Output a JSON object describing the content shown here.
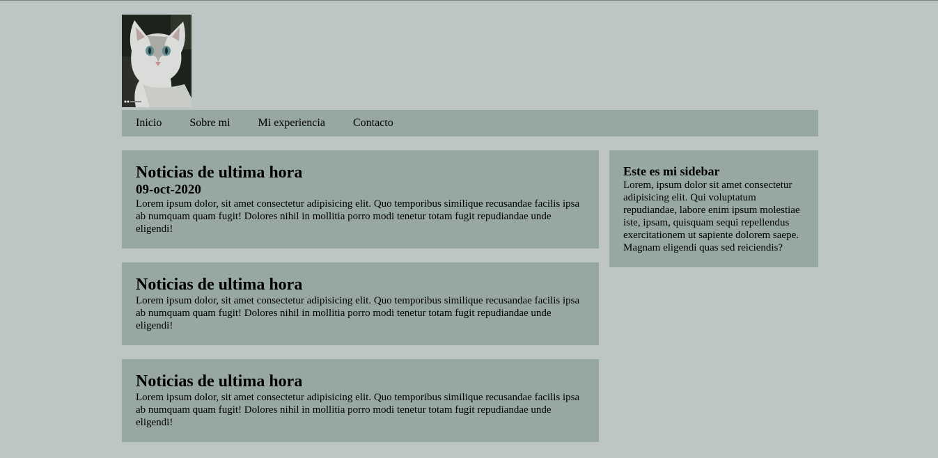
{
  "header": {
    "logo_icon": "cat-photo"
  },
  "nav": {
    "items": [
      "Inicio",
      "Sobre mi",
      "Mi experiencia",
      "Contacto"
    ]
  },
  "articles": [
    {
      "title": "Noticias de ultima hora",
      "date": "09-oct-2020",
      "body": "Lorem ipsum dolor, sit amet consectetur adipisicing elit. Quo temporibus similique recusandae facilis ipsa ab numquam quam fugit! Dolores nihil in mollitia porro modi tenetur totam fugit repudiandae unde eligendi!"
    },
    {
      "title": "Noticias de ultima hora",
      "body": "Lorem ipsum dolor, sit amet consectetur adipisicing elit. Quo temporibus similique recusandae facilis ipsa ab numquam quam fugit! Dolores nihil in mollitia porro modi tenetur totam fugit repudiandae unde eligendi!"
    },
    {
      "title": "Noticias de ultima hora",
      "body": "Lorem ipsum dolor, sit amet consectetur adipisicing elit. Quo temporibus similique recusandae facilis ipsa ab numquam quam fugit! Dolores nihil in mollitia porro modi tenetur totam fugit repudiandae unde eligendi!"
    }
  ],
  "sidebar": {
    "title": "Este es mi sidebar",
    "body": "Lorem, ipsum dolor sit amet consectetur adipisicing elit. Qui voluptatum repudiandae, labore enim ipsum molestiae iste, ipsam, quisquam sequi repellendus exercitationem ut sapiente dolorem saepe. Magnam eligendi quas sed reiciendis?"
  },
  "colors": {
    "page_background": "#bdc6c4",
    "panel_background": "#97a8a2"
  }
}
